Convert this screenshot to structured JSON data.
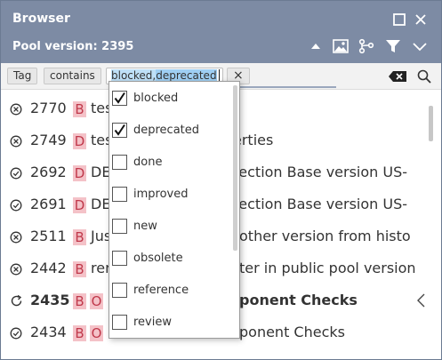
{
  "header": {
    "title": "Browser",
    "pool_version": "Pool version: 2395"
  },
  "filter": {
    "field": "Tag",
    "operator": "contains",
    "value_part1": "blocked,",
    "value_part2": "deprecated",
    "clear": "×"
  },
  "dropdown": {
    "options": [
      {
        "label": "blocked",
        "checked": true
      },
      {
        "label": "deprecated",
        "checked": true
      },
      {
        "label": "done",
        "checked": false
      },
      {
        "label": "improved",
        "checked": false
      },
      {
        "label": "new",
        "checked": false
      },
      {
        "label": "obsolete",
        "checked": false
      },
      {
        "label": "reference",
        "checked": false
      },
      {
        "label": "review",
        "checked": false
      }
    ]
  },
  "rows": [
    {
      "id": "2770",
      "status": "blocked",
      "badges": [
        "B"
      ],
      "pre": "tes",
      "text": "",
      "bold": false
    },
    {
      "id": "2749",
      "status": "blocked",
      "badges": [
        "D"
      ],
      "pre": "tes",
      "text": "erties",
      "bold": false
    },
    {
      "id": "2692",
      "status": "done",
      "badges": [
        "D"
      ],
      "pre": "DE",
      "text": "tection Base version US-",
      "bold": false
    },
    {
      "id": "2691",
      "status": "done",
      "badges": [
        "D"
      ],
      "pre": "DE",
      "text": "tection Base version US-",
      "bold": false
    },
    {
      "id": "2511",
      "status": "blocked",
      "badges": [
        "B"
      ],
      "pre": "Jus",
      "text": "other version from histo",
      "bold": false
    },
    {
      "id": "2442",
      "status": "blocked",
      "badges": [
        "B"
      ],
      "pre": "rer",
      "text": "ter in public pool version",
      "bold": false
    },
    {
      "id": "2435",
      "status": "sync",
      "badges": [
        "B",
        "O"
      ],
      "pre": "",
      "text": "ponent Checks",
      "bold": true
    },
    {
      "id": "2434",
      "status": "done",
      "badges": [
        "B",
        "O"
      ],
      "pre": "",
      "text": "ponent Checks",
      "bold": false
    }
  ],
  "colors": {
    "header_bg": "#7d8ba4",
    "badge_bg": "#f4c2c8",
    "badge_fg": "#c0394b",
    "value_highlight": "#bfe0f7"
  }
}
